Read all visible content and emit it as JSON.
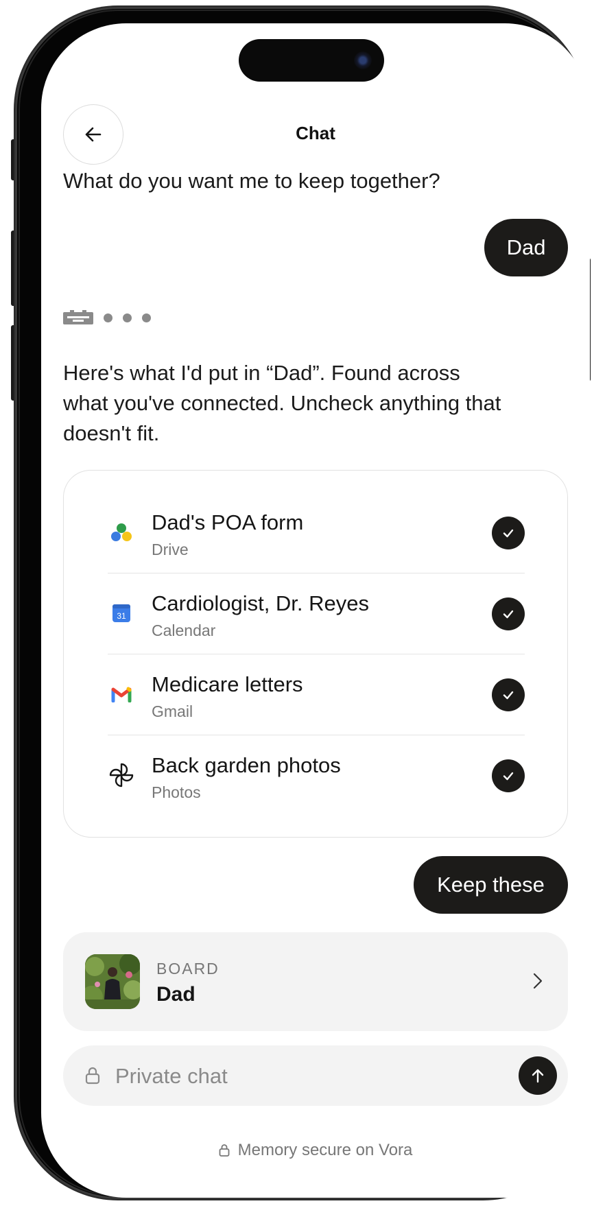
{
  "header": {
    "title": "Chat"
  },
  "conversation": {
    "question": "What do you want me to keep together?",
    "user_reply": "Dad",
    "assistant_text": "Here's what I'd put in “Dad”. Found across what you've connected. Uncheck anything that doesn't fit.",
    "user_confirm": "Keep these"
  },
  "items": [
    {
      "title": "Dad's POA form",
      "source": "Drive",
      "icon": "google-drive-icon",
      "checked": true
    },
    {
      "title": "Cardiologist, Dr. Reyes",
      "source": "Calendar",
      "icon": "google-calendar-icon",
      "calendar_day": "31",
      "checked": true
    },
    {
      "title": "Medicare letters",
      "source": "Gmail",
      "icon": "gmail-icon",
      "checked": true
    },
    {
      "title": "Back garden photos",
      "source": "Photos",
      "icon": "photos-pinwheel-icon",
      "checked": true
    }
  ],
  "board": {
    "kicker": "BOARD",
    "name": "Dad"
  },
  "composer": {
    "placeholder": "Private chat"
  },
  "footer": {
    "text": "Memory secure on Vora"
  },
  "colors": {
    "dark": "#1c1b19",
    "surface": "#f3f3f3",
    "muted": "#777777",
    "border": "#e1e1e1"
  }
}
